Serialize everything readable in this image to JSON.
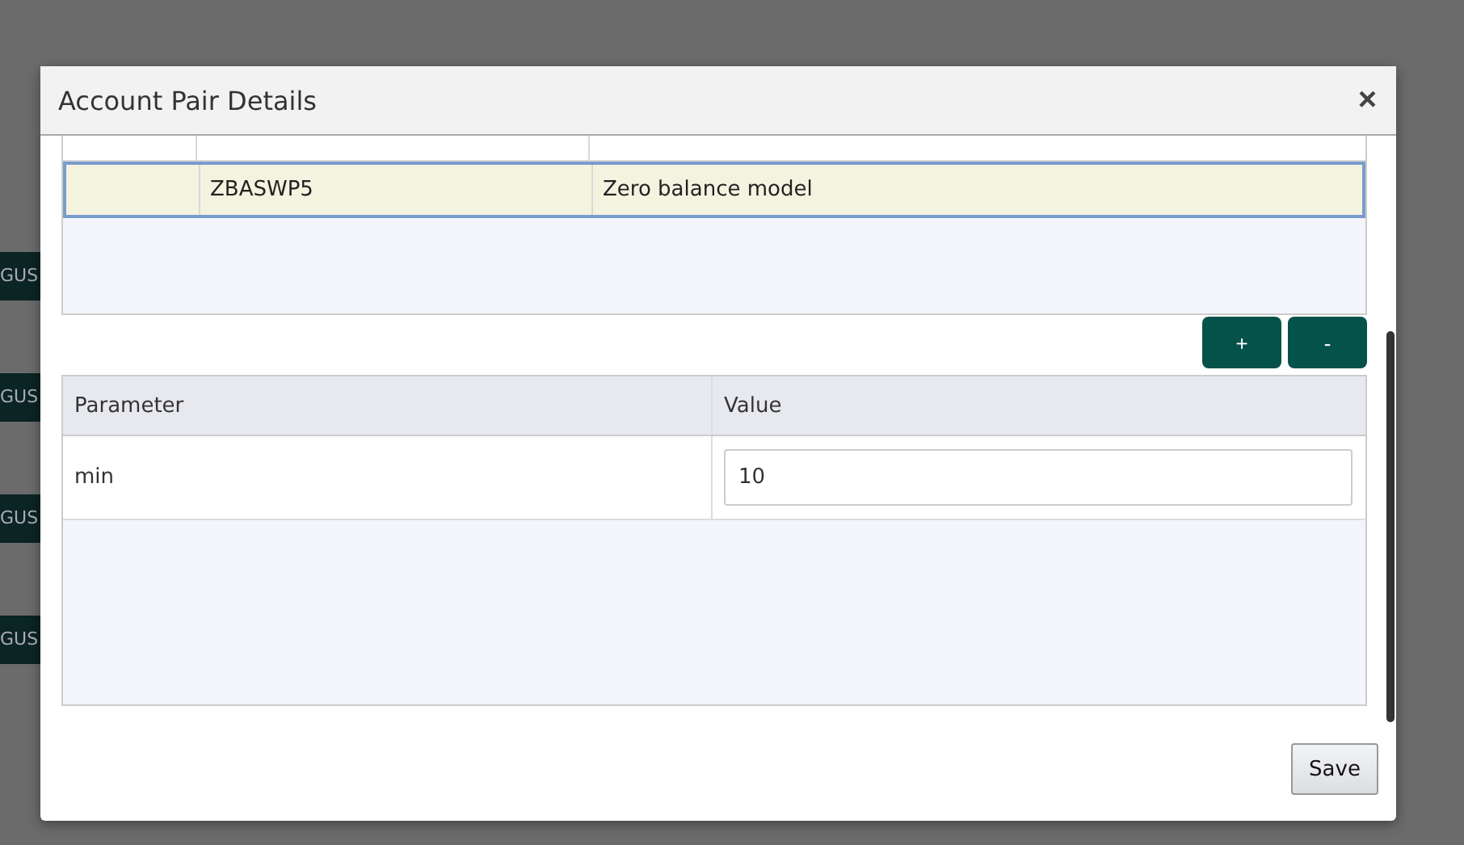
{
  "background_labels": [
    "GUS",
    "GUS",
    "GUS",
    "GUS"
  ],
  "dialog": {
    "title": "Account Pair Details",
    "close": "×"
  },
  "accounts_table": {
    "rows": [
      {
        "code": "ZBASWP5",
        "description": "Zero balance model",
        "selected": true
      }
    ]
  },
  "row_buttons": {
    "add": "+",
    "remove": "-"
  },
  "parameters_table": {
    "columns": [
      "Parameter",
      "Value"
    ],
    "rows": [
      {
        "parameter": "min",
        "value": "10"
      }
    ]
  },
  "save_button": "Save"
}
